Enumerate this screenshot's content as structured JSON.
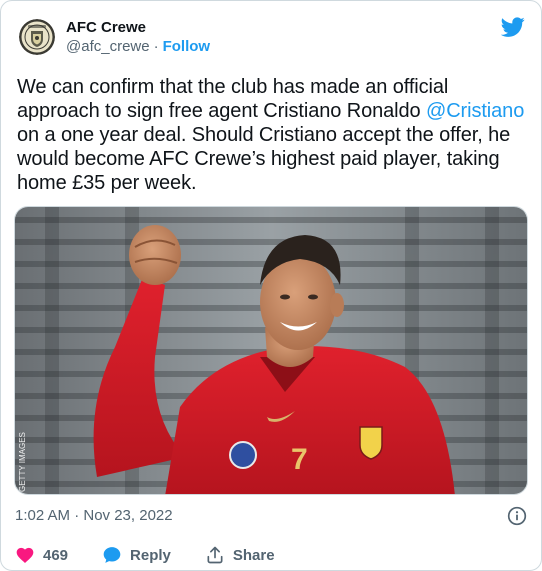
{
  "account": {
    "display_name": "AFC Crewe",
    "handle": "@afc_crewe",
    "separator": "·",
    "follow_label": "Follow",
    "avatar_icon": "club-crest"
  },
  "tweet": {
    "text_before": "We can confirm that the club has made an official approach to sign free agent Cristiano Ronaldo ",
    "mention": "@Cristiano",
    "text_after": " on a one year deal. Should Cristiano accept the offer, he would become AFC Crewe’s highest paid player, taking home £35 per week.",
    "timestamp": "1:02 AM · Nov 23, 2022"
  },
  "photo": {
    "credit": "GETTY IMAGES",
    "jersey_number": "7"
  },
  "actions": {
    "like_count": "469",
    "reply_label": "Reply",
    "share_label": "Share"
  },
  "colors": {
    "accent": "#1d9bf0",
    "like": "#f91880",
    "muted": "#536471",
    "text": "#0f1419"
  }
}
